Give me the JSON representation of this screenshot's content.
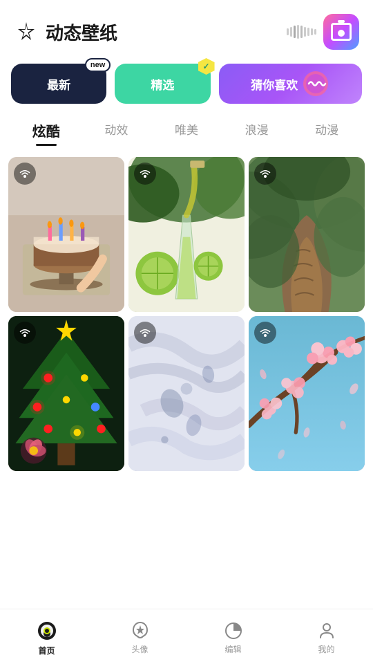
{
  "header": {
    "title": "动态壁纸",
    "camera_aria": "camera button"
  },
  "category_tabs": [
    {
      "id": "newest",
      "label": "最新",
      "badge": "new",
      "style": "newest"
    },
    {
      "id": "featured",
      "label": "精选",
      "style": "featured"
    },
    {
      "id": "recommend",
      "label": "猜你喜欢",
      "style": "recommend"
    }
  ],
  "sub_tabs": [
    {
      "id": "cool",
      "label": "炫酷",
      "active": true
    },
    {
      "id": "effect",
      "label": "动效"
    },
    {
      "id": "beautiful",
      "label": "唯美"
    },
    {
      "id": "romance",
      "label": "浪漫"
    },
    {
      "id": "anime",
      "label": "动漫"
    }
  ],
  "grid_items": [
    {
      "id": 1,
      "style": "cake",
      "alt": "蛋糕壁纸"
    },
    {
      "id": 2,
      "style": "drink",
      "alt": "饮料壁纸"
    },
    {
      "id": 3,
      "style": "tree",
      "alt": "树木壁纸"
    },
    {
      "id": 4,
      "style": "christmas",
      "alt": "圣诞壁纸"
    },
    {
      "id": 5,
      "style": "abstract",
      "alt": "抽象壁纸"
    },
    {
      "id": 6,
      "style": "blossom",
      "alt": "花朵壁纸"
    }
  ],
  "bottom_nav": [
    {
      "id": "home",
      "label": "首页",
      "active": true
    },
    {
      "id": "avatar",
      "label": "头像",
      "active": false
    },
    {
      "id": "edit",
      "label": "编辑",
      "active": false
    },
    {
      "id": "profile",
      "label": "我的",
      "active": false
    }
  ],
  "wifi_icon": "((·))",
  "colors": {
    "newest_bg": "#1a2340",
    "featured_bg": "#3dd6a3",
    "recommend_bg": "#8b5cf6",
    "active_tab": "#1a1a1a",
    "inactive_tab": "#999999"
  }
}
